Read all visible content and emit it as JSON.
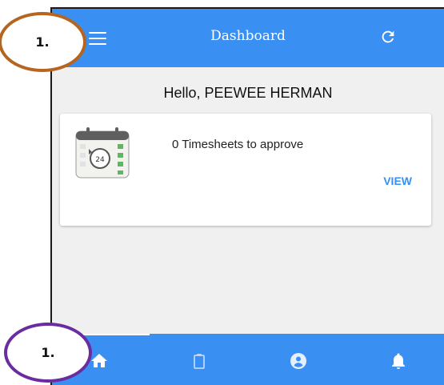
{
  "topbar": {
    "title": "Dashboard",
    "menu_icon": "menu-icon",
    "refresh_icon": "refresh-icon"
  },
  "greeting": "Hello, PEEWEE HERMAN",
  "card": {
    "icon": "calendar-24h-icon",
    "icon_number": "24",
    "message": "0 Timesheets to approve",
    "action_label": "VIEW"
  },
  "bottom_nav": {
    "items": [
      {
        "icon": "home-icon",
        "active": true
      },
      {
        "icon": "clipboard-icon",
        "active": false
      },
      {
        "icon": "account-circle-icon",
        "active": false
      },
      {
        "icon": "bell-icon",
        "active": false
      }
    ]
  },
  "annotations": {
    "top_label": "1.",
    "bottom_label": "1."
  },
  "colors": {
    "primary": "#3a8ff3",
    "background": "#f0f0f0",
    "annotation_top": "#b5651d",
    "annotation_bottom": "#6a2da0"
  }
}
